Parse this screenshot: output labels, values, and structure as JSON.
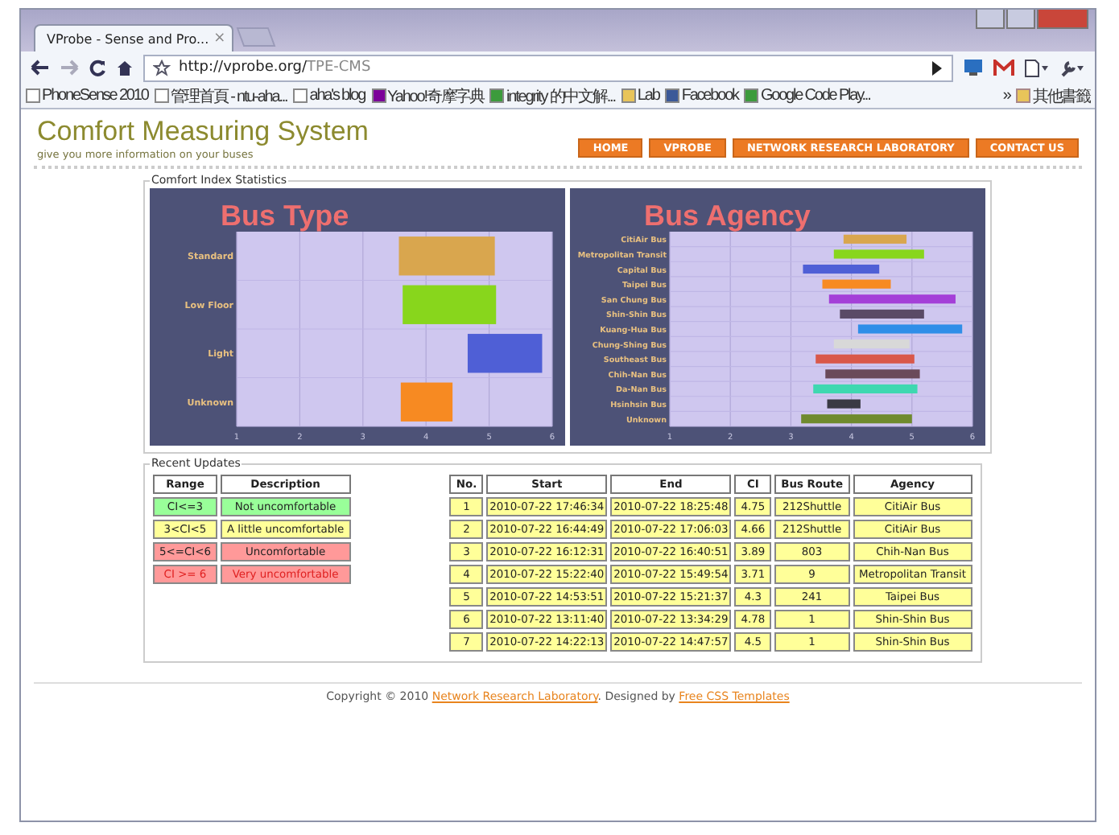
{
  "browser": {
    "tab": {
      "title": "VProbe - Sense and Pro...",
      "close": "×"
    },
    "url": {
      "host": "http://vprobe.org/",
      "path": "TPE-CMS"
    },
    "bookmarks": [
      {
        "label": "PhoneSense 2010",
        "kind": "page"
      },
      {
        "label": "管理首頁 - ntu-aha...",
        "kind": "page"
      },
      {
        "label": "aha's blog",
        "kind": "page"
      },
      {
        "label": "Yahoo!奇摩字典",
        "kind": "yahoo"
      },
      {
        "label": "integrity 的中文解...",
        "kind": "google"
      },
      {
        "label": "Lab",
        "kind": "folder"
      },
      {
        "label": "Facebook",
        "kind": "facebook"
      },
      {
        "label": "Google Code Play...",
        "kind": "google"
      }
    ],
    "more": "»",
    "other_bookmarks": "其他書籤"
  },
  "site": {
    "title": "Comfort Measuring System",
    "tagline": "give you more information on your buses",
    "nav": [
      "HOME",
      "VPROBE",
      "NETWORK RESEARCH LABORATORY",
      "CONTACT US"
    ]
  },
  "stats": {
    "legend": "Comfort Index Statistics",
    "charts": [
      {
        "chart_data": {
          "type": "candlestick",
          "orientation": "horizontal",
          "grid": true,
          "title": "Bus Type",
          "categories": [
            "Standard",
            "Low Floor",
            "Light",
            "Unknown"
          ],
          "xlim": [
            1,
            6
          ],
          "xticks": [
            1,
            2,
            3,
            4,
            5,
            6
          ],
          "ohlc": [
            [
              3.57,
              5.09,
              3.57,
              5.09
            ],
            [
              3.63,
              5.11,
              3.63,
              5.11
            ],
            [
              4.66,
              5.84,
              4.66,
              5.84
            ],
            [
              3.6,
              4.42,
              3.6,
              4.42
            ]
          ],
          "colors": [
            "#d9a64e",
            "#88d61c",
            "#4f5fd6",
            "#f78a22"
          ]
        }
      },
      {
        "chart_data": {
          "type": "candlestick",
          "orientation": "horizontal",
          "grid": true,
          "title": "Bus Agency",
          "categories": [
            "CitiAir Bus",
            "Metropolitan Transit",
            "Capital Bus",
            "Taipei Bus",
            "San Chung Bus",
            "Shin-Shin Bus",
            "Kuang-Hua Bus",
            "Chung-Shing Bus",
            "Southeast Bus",
            "Chih-Nan Bus",
            "Da-Nan Bus",
            "Hsinhsin Bus",
            "Unknown"
          ],
          "xlim": [
            1,
            6
          ],
          "xticks": [
            1,
            2,
            3,
            4,
            5,
            6
          ],
          "ohlc": [
            [
              3.87,
              4.91,
              3.87,
              4.91
            ],
            [
              3.71,
              5.2,
              3.71,
              5.2
            ],
            [
              3.2,
              4.46,
              3.2,
              4.46
            ],
            [
              3.52,
              4.65,
              3.52,
              4.65
            ],
            [
              3.63,
              5.72,
              3.63,
              5.72
            ],
            [
              3.81,
              5.2,
              3.81,
              5.2
            ],
            [
              4.11,
              5.83,
              4.11,
              5.83
            ],
            [
              3.71,
              4.96,
              3.71,
              4.96
            ],
            [
              3.41,
              5.04,
              3.41,
              5.04
            ],
            [
              3.57,
              5.13,
              3.57,
              5.13
            ],
            [
              3.37,
              5.09,
              3.37,
              5.09
            ],
            [
              3.6,
              4.15,
              3.6,
              4.15
            ],
            [
              3.17,
              5.0,
              3.17,
              5.0
            ]
          ],
          "colors": [
            "#d9a64e",
            "#88d61c",
            "#4f5fd6",
            "#f78a22",
            "#a43fd8",
            "#5a4a66",
            "#2f8ee8",
            "#d8d8d8",
            "#d9584a",
            "#6a4a5a",
            "#3ed8b0",
            "#3a3a44",
            "#6f8a2e"
          ]
        }
      }
    ]
  },
  "updates": {
    "legend": "Recent Updates",
    "ranges": {
      "columns": [
        "Range",
        "Description"
      ],
      "rows": [
        {
          "range": "CI<=3",
          "description": "Not uncomfortable",
          "color": "#99ff99",
          "alert": false
        },
        {
          "range": "3<CI<5",
          "description": "A little uncomfortable",
          "color": "#ffff99",
          "alert": false
        },
        {
          "range": "5<=CI<6",
          "description": "Uncomfortable",
          "color": "#ff9999",
          "alert": false
        },
        {
          "range": "CI >= 6",
          "description": "Very uncomfortable",
          "color": "#ff9999",
          "alert": true
        }
      ]
    },
    "records": {
      "columns": [
        "No.",
        "Start",
        "End",
        "CI",
        "Bus Route",
        "Agency"
      ],
      "rows": [
        {
          "cells": [
            "1",
            "2010-07-22 17:46:34",
            "2010-07-22 18:25:48",
            "4.75",
            "212Shuttle",
            "CitiAir Bus"
          ],
          "color": "#ffff99"
        },
        {
          "cells": [
            "2",
            "2010-07-22 16:44:49",
            "2010-07-22 17:06:03",
            "4.66",
            "212Shuttle",
            "CitiAir Bus"
          ],
          "color": "#ffff99"
        },
        {
          "cells": [
            "3",
            "2010-07-22 16:12:31",
            "2010-07-22 16:40:51",
            "3.89",
            "803",
            "Chih-Nan Bus"
          ],
          "color": "#ffff99"
        },
        {
          "cells": [
            "4",
            "2010-07-22 15:22:40",
            "2010-07-22 15:49:54",
            "3.71",
            "9",
            "Metropolitan Transit"
          ],
          "color": "#ffff99"
        },
        {
          "cells": [
            "5",
            "2010-07-22 14:53:51",
            "2010-07-22 15:21:37",
            "4.3",
            "241",
            "Taipei Bus"
          ],
          "color": "#ffff99"
        },
        {
          "cells": [
            "6",
            "2010-07-22 13:11:40",
            "2010-07-22 13:34:29",
            "4.78",
            "1",
            "Shin-Shin Bus"
          ],
          "color": "#ffff99"
        },
        {
          "cells": [
            "7",
            "2010-07-22 14:22:13",
            "2010-07-22 14:47:57",
            "4.5",
            "1",
            "Shin-Shin Bus"
          ],
          "color": "#ffff99"
        }
      ]
    }
  },
  "footer": {
    "prefix": "Copyright © 2010 ",
    "link1": "Network Research Laboratory",
    "middle": ". Designed by ",
    "link2": "Free CSS Templates"
  }
}
